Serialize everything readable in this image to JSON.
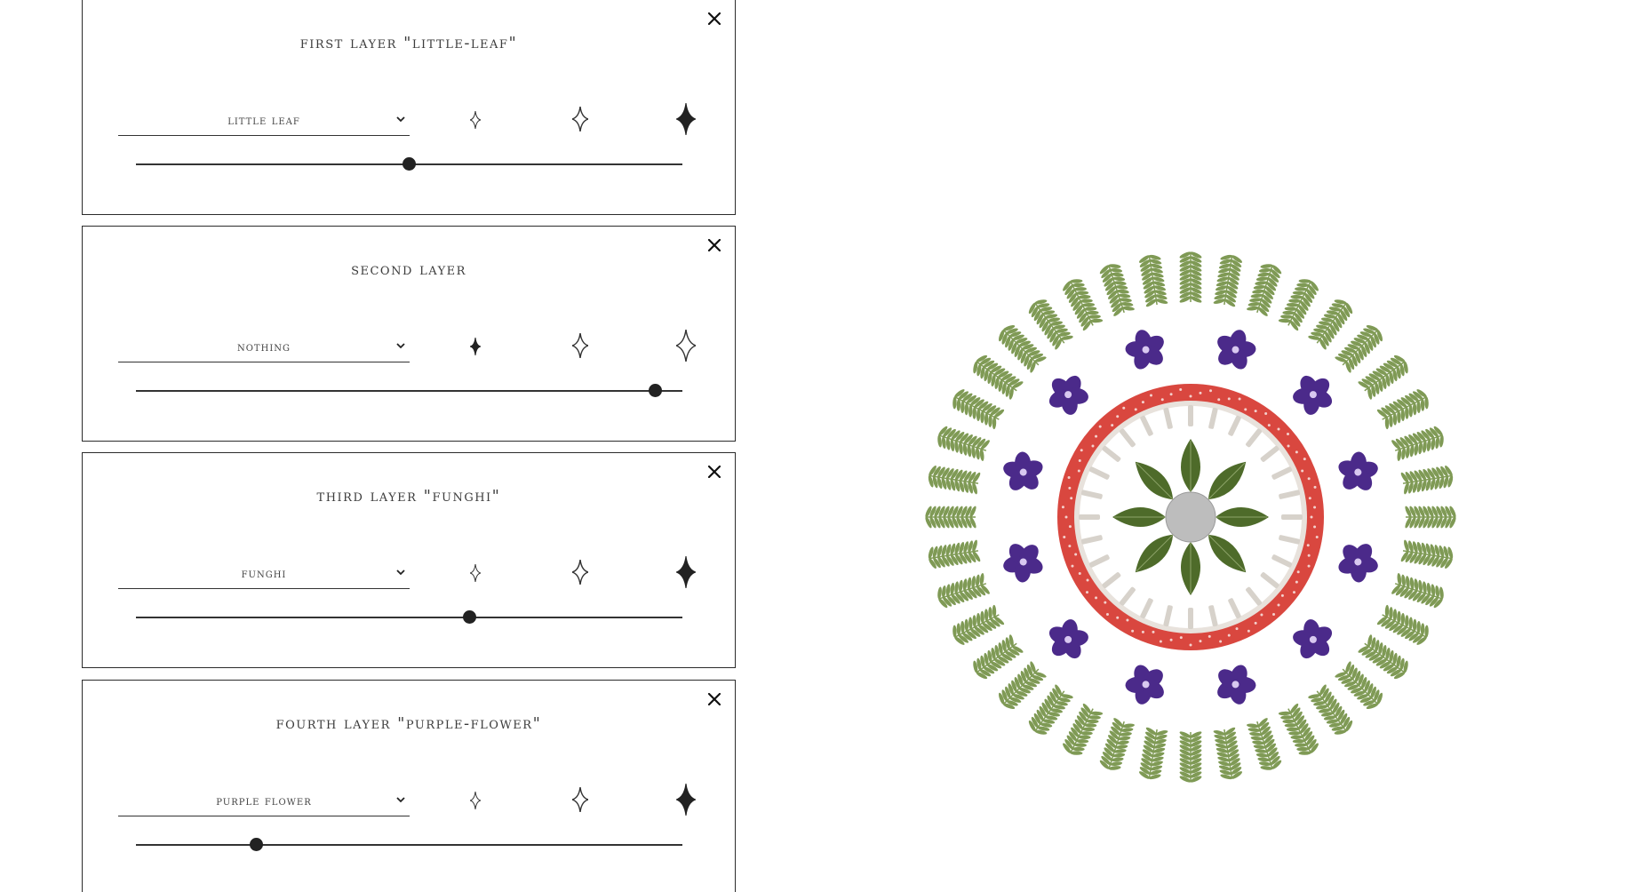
{
  "layers": [
    {
      "title": "FIRST LAYER \"LITTLE-LEAF\"",
      "select_value": "LITTLE LEAF",
      "size_options": [
        "small-star-icon",
        "medium-star-icon",
        "large-star-icon"
      ],
      "selected_size": 2,
      "slider_value": 0.5
    },
    {
      "title": "SECOND LAYER",
      "select_value": "NOTHING",
      "size_options": [
        "small-star-icon",
        "medium-star-icon",
        "large-star-icon"
      ],
      "selected_size": 0,
      "slider_value": 0.95
    },
    {
      "title": "THIRD LAYER \"FUNGHI\"",
      "select_value": "FUNGHI",
      "size_options": [
        "small-star-icon",
        "medium-star-icon",
        "large-star-icon"
      ],
      "selected_size": 2,
      "slider_value": 0.61
    },
    {
      "title": "FOURTH LAYER \"PURPLE-FLOWER\"",
      "select_value": "PURPLE FLOWER",
      "size_options": [
        "small-star-icon",
        "medium-star-icon",
        "large-star-icon"
      ],
      "selected_size": 2,
      "slider_value": 0.22
    }
  ],
  "colors": {
    "leaf": "#7f9a55",
    "flower": "#4b2a8a",
    "mushroom_cap": "#d9473f",
    "center_leaf": "#4e6b2a",
    "moon": "#bdbdbd"
  }
}
